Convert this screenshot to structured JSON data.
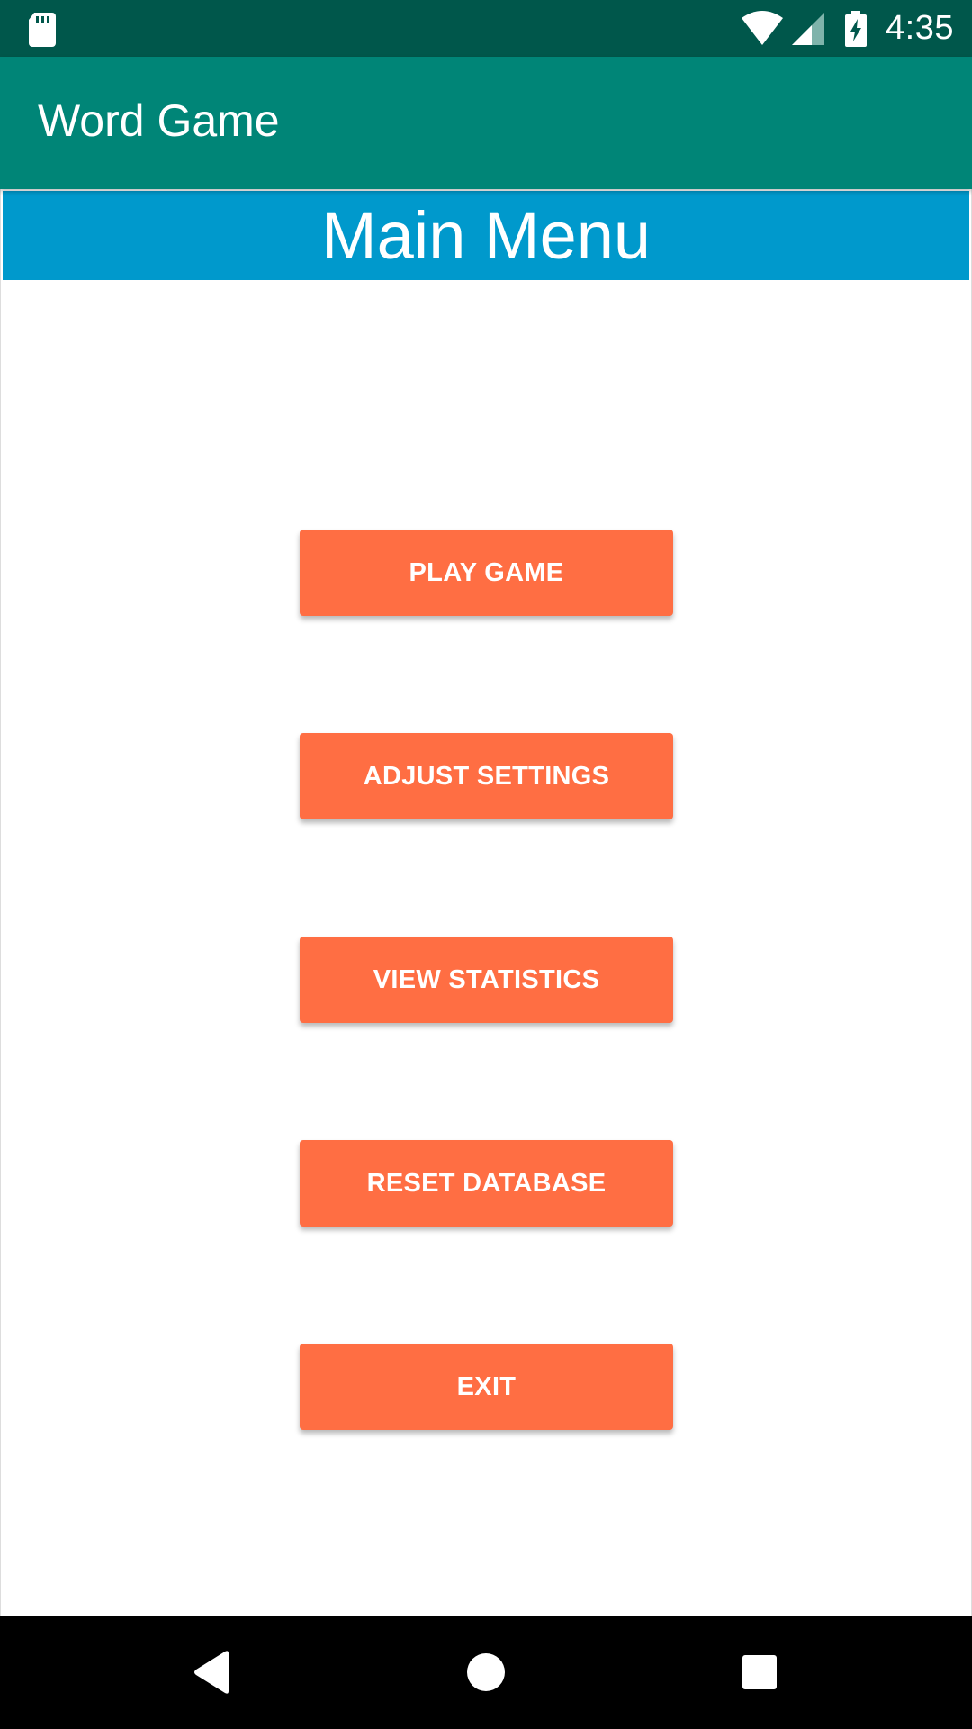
{
  "status_bar": {
    "time": "4:35",
    "icons": [
      "sd-card-icon",
      "wifi-icon",
      "cell-signal-icon",
      "battery-charging-icon"
    ]
  },
  "app_bar": {
    "title": "Word Game"
  },
  "main": {
    "header": "Main Menu",
    "buttons": [
      {
        "label": "PLAY GAME"
      },
      {
        "label": "ADJUST SETTINGS"
      },
      {
        "label": "VIEW STATISTICS"
      },
      {
        "label": "RESET DATABASE"
      },
      {
        "label": "EXIT"
      }
    ]
  },
  "nav_bar": {
    "icons": [
      "back-icon",
      "home-icon",
      "recents-icon"
    ]
  },
  "colors": {
    "status_bar": "#00574b",
    "app_bar": "#008577",
    "header": "#0099cc",
    "button": "#ff6e43",
    "nav_bar": "#000000"
  }
}
